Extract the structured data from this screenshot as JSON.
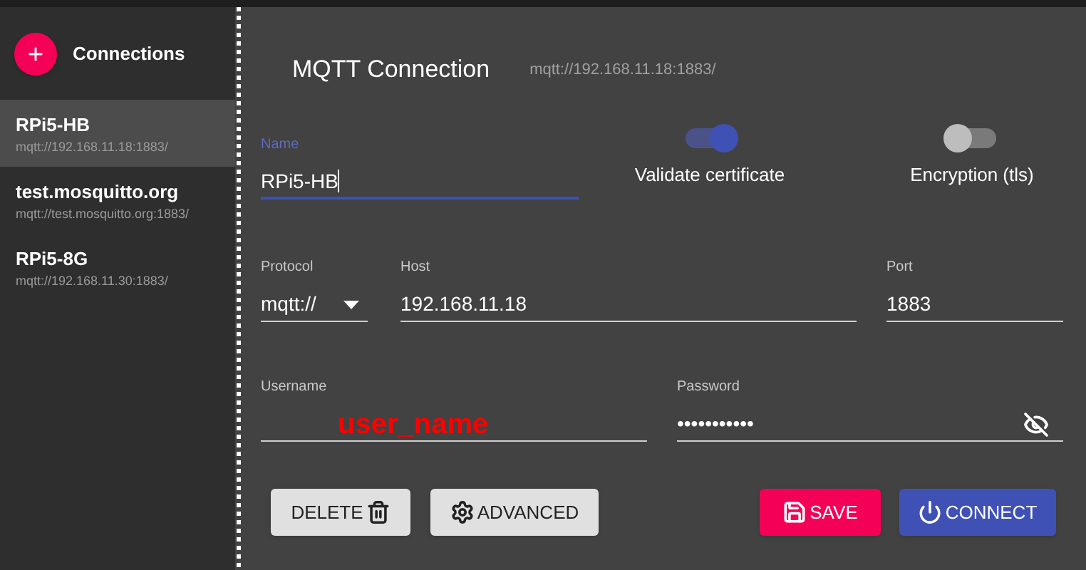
{
  "sidebar": {
    "title": "Connections",
    "items": [
      {
        "name": "RPi5-HB",
        "url": "mqtt://192.168.11.18:1883/",
        "selected": true
      },
      {
        "name": "test.mosquitto.org",
        "url": "mqtt://test.mosquitto.org:1883/",
        "selected": false
      },
      {
        "name": "RPi5-8G",
        "url": "mqtt://192.168.11.30:1883/",
        "selected": false
      }
    ]
  },
  "header": {
    "title": "MQTT Connection",
    "url": "mqtt://192.168.11.18:1883/"
  },
  "name_field": {
    "label": "Name",
    "value": "RPi5-HB",
    "focused": true
  },
  "toggles": [
    {
      "label": "Validate certificate",
      "on": true
    },
    {
      "label": "Encryption (tls)",
      "on": false
    }
  ],
  "protocol": {
    "label": "Protocol",
    "value": "mqtt://"
  },
  "host": {
    "label": "Host",
    "value": "192.168.11.18"
  },
  "port": {
    "label": "Port",
    "value": "1883"
  },
  "username": {
    "label": "Username",
    "value": "user_name"
  },
  "password": {
    "label": "Password",
    "value": "•••••••••••"
  },
  "buttons": [
    {
      "label": "DELETE",
      "kind": "delete"
    },
    {
      "label": "ADVANCED",
      "kind": "advanced"
    },
    {
      "label": "SAVE",
      "kind": "save"
    },
    {
      "label": "CONNECT",
      "kind": "connect"
    }
  ]
}
